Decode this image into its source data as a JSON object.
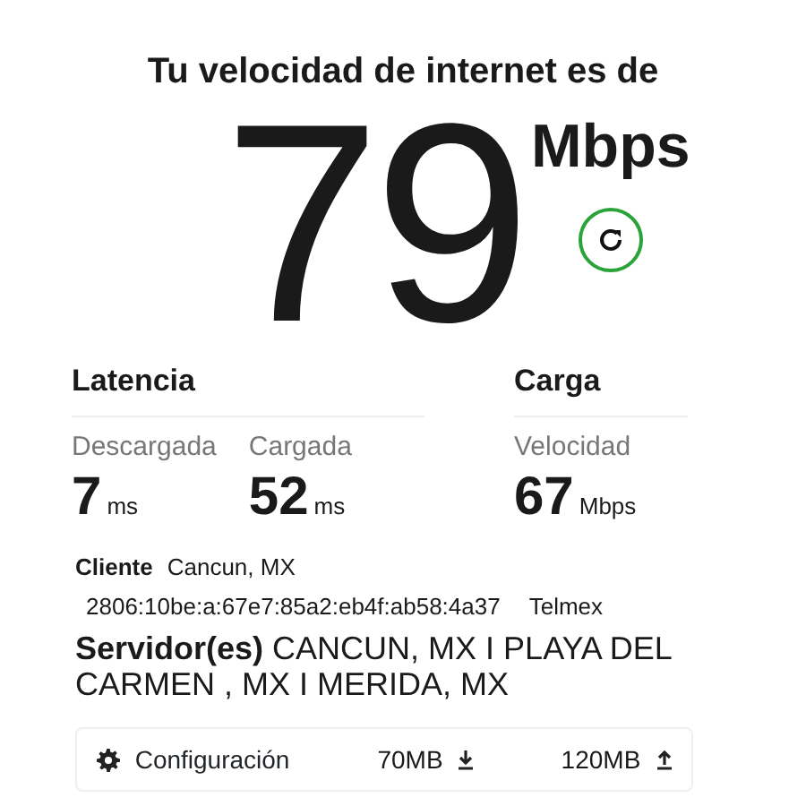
{
  "title": "Tu velocidad de internet es de",
  "speed": {
    "value": "79",
    "unit": "Mbps"
  },
  "sections": [
    {
      "heading": "Latencia",
      "metrics": [
        {
          "label": "Descargada",
          "value": "7",
          "unit": "ms"
        },
        {
          "label": "Cargada",
          "value": "52",
          "unit": "ms"
        }
      ]
    },
    {
      "heading": "Carga",
      "metrics": [
        {
          "label": "Velocidad",
          "value": "67",
          "unit": "Mbps"
        }
      ]
    }
  ],
  "client": {
    "label": "Cliente",
    "location": "Cancun, MX",
    "ip": "2806:10be:a:67e7:85a2:eb4f:ab58:4a37",
    "isp": "Telmex"
  },
  "servers": "**Servidor(es)** CANCUN, MX  I  PLAYA DEL CARMEN , MX  I  MERIDA, MX",
  "footer": {
    "settings": "Configuración",
    "download": "70MB",
    "upload": "120MB"
  }
}
